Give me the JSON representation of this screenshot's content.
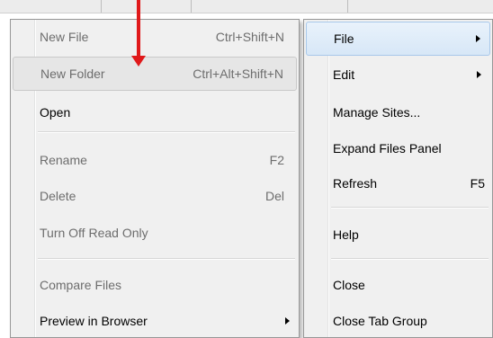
{
  "left_menu": {
    "items": [
      {
        "label": "New File",
        "shortcut": "Ctrl+Shift+N",
        "disabled": true
      },
      {
        "label": "New Folder",
        "shortcut": "Ctrl+Alt+Shift+N",
        "disabled": true
      },
      {
        "label": "Open",
        "shortcut": "",
        "disabled": false
      },
      {
        "label": "Rename",
        "shortcut": "F2",
        "disabled": true
      },
      {
        "label": "Delete",
        "shortcut": "Del",
        "disabled": true
      },
      {
        "label": "Turn Off Read Only",
        "shortcut": "",
        "disabled": true
      },
      {
        "label": "Compare Files",
        "shortcut": "",
        "disabled": true
      },
      {
        "label": "Preview in Browser",
        "shortcut": "",
        "disabled": false
      }
    ]
  },
  "right_menu": {
    "items": [
      {
        "label": "File",
        "shortcut": ""
      },
      {
        "label": "Edit",
        "shortcut": ""
      },
      {
        "label": "Manage Sites...",
        "shortcut": ""
      },
      {
        "label": "Expand Files Panel",
        "shortcut": ""
      },
      {
        "label": "Refresh",
        "shortcut": "F5"
      },
      {
        "label": "Help",
        "shortcut": ""
      },
      {
        "label": "Close",
        "shortcut": ""
      },
      {
        "label": "Close Tab Group",
        "shortcut": ""
      }
    ]
  },
  "colors": {
    "menu_bg": "#f0f0f0",
    "disabled_text": "#6d6d6d",
    "active_highlight": "#d7e7f7",
    "pointer_arrow": "#e0191a"
  }
}
